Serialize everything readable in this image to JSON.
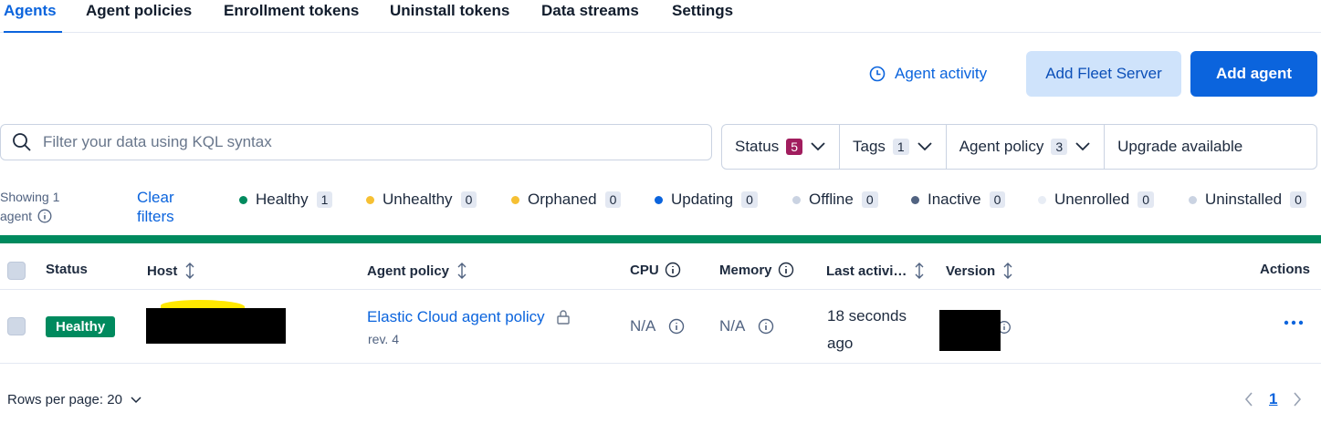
{
  "tabs": [
    "Agents",
    "Agent policies",
    "Enrollment tokens",
    "Uninstall tokens",
    "Data streams",
    "Settings"
  ],
  "header": {
    "agent_activity": "Agent activity",
    "add_fleet_server": "Add Fleet Server",
    "add_agent": "Add agent"
  },
  "search": {
    "placeholder": "Filter your data using KQL syntax",
    "value": ""
  },
  "filters": {
    "status": {
      "label": "Status",
      "count": "5"
    },
    "tags": {
      "label": "Tags",
      "count": "1"
    },
    "agent_policy": {
      "label": "Agent policy",
      "count": "3"
    },
    "upgrade": {
      "label": "Upgrade available"
    }
  },
  "summary": {
    "showing": "Showing 1 agent",
    "clear": "Clear filters"
  },
  "legend": [
    {
      "label": "Healthy",
      "count": "1",
      "color": "#008a5e"
    },
    {
      "label": "Unhealthy",
      "count": "0",
      "color": "#f6c033"
    },
    {
      "label": "Orphaned",
      "count": "0",
      "color": "#f6c033"
    },
    {
      "label": "Updating",
      "count": "0",
      "color": "#0b64dd"
    },
    {
      "label": "Offline",
      "count": "0",
      "color": "#cad3e2"
    },
    {
      "label": "Inactive",
      "count": "0",
      "color": "#516381"
    },
    {
      "label": "Unenrolled",
      "count": "0",
      "color": "#e8edf5"
    },
    {
      "label": "Uninstalled",
      "count": "0",
      "color": "#cad3e2"
    }
  ],
  "table": {
    "columns": {
      "status": "Status",
      "host": "Host",
      "agent_policy": "Agent policy",
      "cpu": "CPU",
      "memory": "Memory",
      "last_activity": "Last activi…",
      "version": "Version",
      "actions": "Actions"
    },
    "rows": [
      {
        "status": "Healthy",
        "agent_policy": "Elastic Cloud agent policy",
        "revision": "rev. 4",
        "cpu": "N/A",
        "memory": "N/A",
        "last_activity": "18 seconds ago"
      }
    ]
  },
  "footer": {
    "rows_per_page": "Rows per page: 20",
    "page": "1"
  },
  "colors": {
    "accent": "#0b64dd",
    "healthy": "#008a5e",
    "status_badge": "#a11d5e"
  }
}
